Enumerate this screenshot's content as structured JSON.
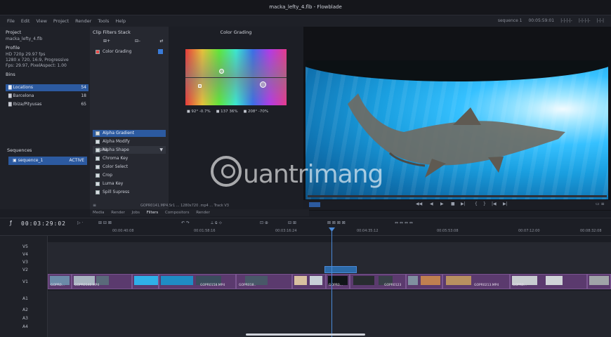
{
  "window": {
    "title": "macka_lefty_4.flb - Flowblade"
  },
  "menu": [
    "File",
    "Edit",
    "View",
    "Project",
    "Render",
    "Tools",
    "Help"
  ],
  "menu_right": {
    "sequence": "sequence 1",
    "time": "00:05:59:01",
    "toggles_1": "|-|-|-|-",
    "toggles_2": "|-|-|-|-",
    "toggles_3": "|-|-|"
  },
  "project": {
    "header": "Project",
    "name": "macka_lefty_4.flb",
    "profile_header": "Profile",
    "profile_lines": [
      "HD 720p 29.97 fps",
      "1280 x 720, 16:9, Progressive",
      "Fps: 29.97, PixelAspect: 1.00"
    ],
    "bins_header": "Bins",
    "bins": [
      {
        "name": "Locations",
        "count": "54"
      },
      {
        "name": "Barcelona",
        "count": "18"
      },
      {
        "name": "Ibiza/Pityusas",
        "count": "65"
      }
    ],
    "sequences_header": "Sequences",
    "sequence": {
      "name": "sequence_1",
      "tag": "ACTIVE"
    }
  },
  "filters": {
    "header": "Clip Filters Stack",
    "btn_add": "⊞+",
    "btn_remove": "⊟–",
    "btn_tool": "⇄",
    "stack": [
      "Color Grading"
    ],
    "category": "Alpha",
    "list": [
      "Alpha Gradient",
      "Alpha Modify",
      "Alpha Shape",
      "Chroma Key",
      "Color Select",
      "Crop",
      "Luma Key",
      "Spill Supress"
    ]
  },
  "color_grading": {
    "header": "Color Grading",
    "values": [
      "92° -0.7%",
      "137 36%",
      "208° -70%"
    ]
  },
  "monitor": {
    "media_info": "GOPR0141.MP4.Sr1 ... 1280x720 .mp4 ... Track V3"
  },
  "bottom_tabs": [
    "Media",
    "Render",
    "Jobs",
    "Filters",
    "Compositors",
    "Render"
  ],
  "active_tab": "Filters",
  "timeline": {
    "timecode": "00:03:29:02",
    "ruler": [
      "00:00:40:08",
      "00:01:58:16",
      "00:03:16:24",
      "00:04:35:12",
      "00:05:53:08",
      "00:07:12:00",
      "00:08:32:08"
    ],
    "video_tracks": [
      "V5",
      "V4",
      "V3",
      "V2",
      "V1"
    ],
    "audio_tracks": [
      "A1",
      "A2",
      "A3",
      "A4"
    ],
    "clip_labels": [
      "GOPR0...",
      "GOPR0140.MP4",
      "GOPR0158.MP4",
      "GOPR018..",
      "GOPR0...",
      "GOPR0123",
      "GOPR0213.MP4",
      "GOPR0...",
      "GOPR0145.MP4"
    ]
  },
  "watermark": "uantrimang"
}
